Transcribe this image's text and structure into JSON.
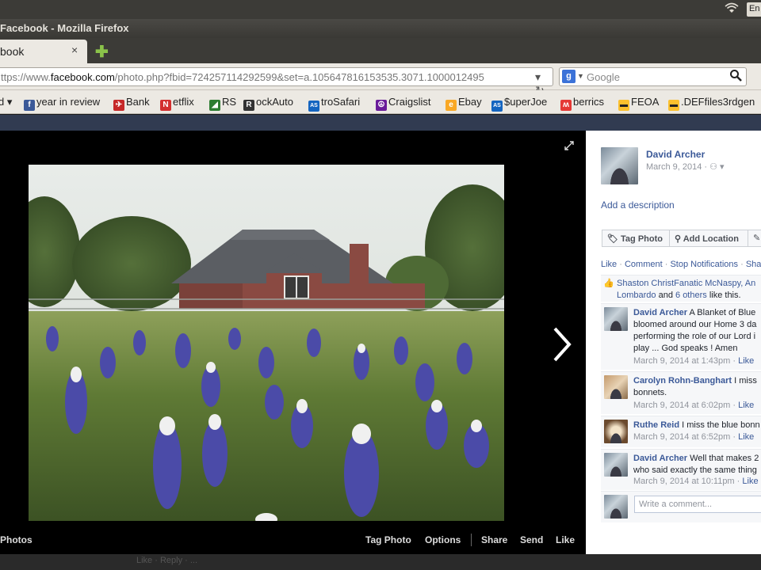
{
  "os": {
    "lang": "En"
  },
  "window": {
    "title": "Facebook - Mozilla Firefox"
  },
  "tab": {
    "label": "book",
    "close": "×"
  },
  "nav": {
    "url_prefix": "ttps://www.",
    "url_domain": "facebook.com",
    "url_rest": "/photo.php?fbid=724257114292599&set=a.105647816153535.3071.1000012495",
    "search_placeholder": "Google"
  },
  "bookmarks": [
    {
      "label": "d ▾",
      "icon": "",
      "color": ""
    },
    {
      "label": "year in review",
      "icon": "f",
      "color": "#3b5998"
    },
    {
      "label": "Bank",
      "icon": "✈",
      "color": "#c62828"
    },
    {
      "label": "etflix",
      "icon": "N",
      "color": "#d32f2f"
    },
    {
      "label": "RS",
      "icon": "◢",
      "color": "#2e7d32"
    },
    {
      "label": "ockAuto",
      "icon": "R",
      "color": "#333333"
    },
    {
      "label": "troSafari",
      "icon": "AS",
      "color": "#1565c0"
    },
    {
      "label": "Craigslist",
      "icon": "☮",
      "color": "#6a1b9a"
    },
    {
      "label": "Ebay",
      "icon": "e",
      "color": "#f9a825"
    },
    {
      "label": "$uperJoe",
      "icon": "AS",
      "color": "#1565c0"
    },
    {
      "label": "berrics",
      "icon": "ʍ",
      "color": "#e53935"
    },
    {
      "label": "FEOA",
      "icon": "▬",
      "color": "#fbc02d"
    },
    {
      "label": ".DEFfiles3rdgen",
      "icon": "▬",
      "color": "#fbc02d"
    }
  ],
  "photo_actions": {
    "photos": "Photos",
    "tag_photo": "Tag Photo",
    "options": "Options",
    "share": "Share",
    "send": "Send",
    "like": "Like"
  },
  "below_stage_text": "Like · Reply · ...",
  "sidebar": {
    "owner_name": "David Archer",
    "owner_date": "March 9, 2014 · ",
    "audience_icon": "friends-icon",
    "add_description": "Add a description",
    "tag_photo_btn": "Tag Photo",
    "add_location_btn": "Add Location",
    "action_links": {
      "like": "Like",
      "comment": "Comment",
      "stop_notifications": "Stop Notifications",
      "share": "Share"
    },
    "likes": {
      "line1": "Shaston ChristFanatic McNaspy, An",
      "line2_name": "Lombardo",
      "line2_and": " and ",
      "line2_others": "6 others",
      "line2_tail": " like this."
    },
    "comments": [
      {
        "author": "David Archer",
        "text_line1": " A Blanket of Blue",
        "more_lines": [
          "bloomed around our Home 3 da",
          "performing the role of our Lord i",
          "play ... God speaks ! Amen"
        ],
        "time": "March 9, 2014 at 1:43pm",
        "like": "Like"
      },
      {
        "author": "Carolyn Rohn-Banghart",
        "text_line1": " I miss",
        "more_lines": [
          "bonnets."
        ],
        "time": "March 9, 2014 at 6:02pm",
        "like": "Like"
      },
      {
        "author": "Ruthe Reid",
        "text_line1": " I miss the blue bonn",
        "more_lines": [],
        "time": "March 9, 2014 at 6:52pm",
        "like": "Like"
      },
      {
        "author": "David Archer",
        "text_line1": " Well that makes 2",
        "more_lines": [
          "who said exactly the same thing"
        ],
        "time": "March 9, 2014 at 10:11pm",
        "like": "Like"
      }
    ],
    "comment_placeholder": "Write a comment..."
  }
}
